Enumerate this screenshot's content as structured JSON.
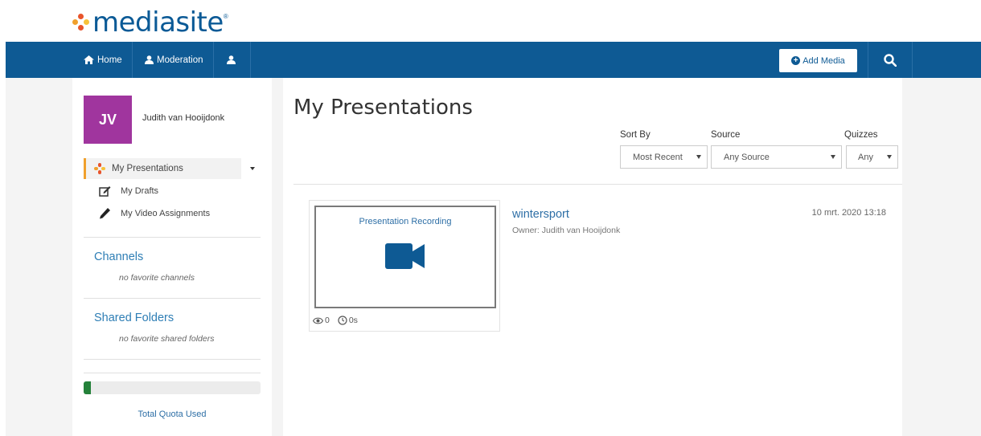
{
  "brand": {
    "name": "mediasite",
    "reg": "®"
  },
  "colors": {
    "nav": "#0e5a94",
    "avatar": "#a0359e",
    "link": "#2e6fa6",
    "active_marker": "#f0a02c",
    "quota": "#24813a"
  },
  "nav": {
    "home_label": "Home",
    "moderation_label": "Moderation",
    "add_media_label": "Add Media",
    "search_icon": "search-icon"
  },
  "user": {
    "initials": "JV",
    "name": "Judith van Hooijdonk"
  },
  "sidebar": {
    "active_item": "My Presentations",
    "items": [
      {
        "label": "My Drafts",
        "icon": "edit-icon"
      },
      {
        "label": "My Video Assignments",
        "icon": "pencil-icon"
      }
    ],
    "channels": {
      "title": "Channels",
      "empty": "no favorite channels"
    },
    "shared_folders": {
      "title": "Shared Folders",
      "empty": "no favorite shared folders"
    },
    "quota": {
      "label": "Total Quota Used",
      "fraction": 0.04
    }
  },
  "main": {
    "title": "My Presentations",
    "filters": {
      "sort_by": {
        "label": "Sort By",
        "value": "Most Recent"
      },
      "source": {
        "label": "Source",
        "value": "Any Source"
      },
      "quizzes": {
        "label": "Quizzes",
        "value": "Any"
      }
    },
    "presentations": [
      {
        "thumb_label": "Presentation Recording",
        "title": "wintersport",
        "owner": "Owner: Judith van Hooijdonk",
        "date": "10 mrt. 2020 13:18",
        "views": "0",
        "duration": "0s"
      }
    ]
  }
}
